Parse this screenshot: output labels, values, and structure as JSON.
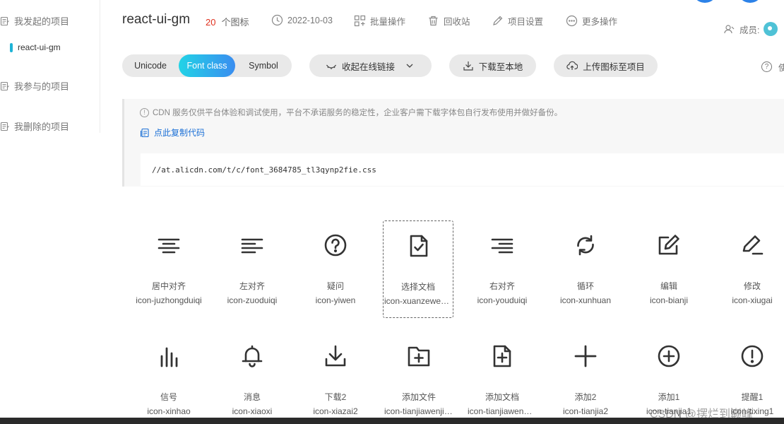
{
  "sidebar": {
    "groups": [
      {
        "label": "我发起的项目",
        "icon": "project-icon"
      },
      {
        "label": "我参与的项目",
        "icon": "project-icon"
      },
      {
        "label": "我删除的项目",
        "icon": "project-icon"
      }
    ],
    "active_project": "react-ui-gm"
  },
  "header": {
    "title": "react-ui-gm",
    "icon_count": "20",
    "icon_count_unit": "个图标",
    "date": "2022-10-03",
    "batch": "批量操作",
    "recycle": "回收站",
    "settings": "项目设置",
    "more": "更多操作",
    "members_label": "成员:"
  },
  "toolbar": {
    "tabs": [
      "Unicode",
      "Font class",
      "Symbol"
    ],
    "active_tab": "Font class",
    "collapse_link": "收起在线链接",
    "download": "下载至本地",
    "upload": "上传图标至项目",
    "help": "?",
    "help_more": "使"
  },
  "notice": {
    "text": "CDN 服务仅供平台体验和调试使用，平台不承诺服务的稳定性，企业客户需下载字体包自行发布使用并做好备份。",
    "copy_label": "点此复制代码",
    "code": "//at.alicdn.com/t/c/font_3684785_tl3qynp2fie.css"
  },
  "icons": [
    {
      "name": "居中对齐",
      "code": "icon-juzhongduiqi",
      "glyph": "align-center-icon"
    },
    {
      "name": "左对齐",
      "code": "icon-zuoduiqi",
      "glyph": "align-left-icon"
    },
    {
      "name": "疑问",
      "code": "icon-yiwen",
      "glyph": "question-icon"
    },
    {
      "name": "选择文档",
      "code": "icon-xuanzewendang",
      "glyph": "document-check-icon",
      "selected": true
    },
    {
      "name": "右对齐",
      "code": "icon-youduiqi",
      "glyph": "align-right-icon"
    },
    {
      "name": "循环",
      "code": "icon-xunhuan",
      "glyph": "loop-icon"
    },
    {
      "name": "编辑",
      "code": "icon-bianji",
      "glyph": "edit-icon"
    },
    {
      "name": "修改",
      "code": "icon-xiugai",
      "glyph": "pen-icon"
    },
    {
      "name": "信号",
      "code": "icon-xinhao",
      "glyph": "signal-icon"
    },
    {
      "name": "消息",
      "code": "icon-xiaoxi",
      "glyph": "bell-icon"
    },
    {
      "name": "下载2",
      "code": "icon-xiazai2",
      "glyph": "download-icon"
    },
    {
      "name": "添加文件",
      "code": "icon-tianjiawenjian",
      "glyph": "folder-add-icon"
    },
    {
      "name": "添加文档",
      "code": "icon-tianjiawendang",
      "glyph": "document-add-icon"
    },
    {
      "name": "添加2",
      "code": "icon-tianjia2",
      "glyph": "plus-icon"
    },
    {
      "name": "添加1",
      "code": "icon-tianjia1",
      "glyph": "plus-circle-icon"
    },
    {
      "name": "提醒1",
      "code": "icon-tixing1",
      "glyph": "alert-circle-icon"
    }
  ],
  "watermark": "CSDN @摆烂到巅峰",
  "colors": {
    "accent": "#22d3e6",
    "link": "#1a6fd6",
    "count": "#e0301e"
  }
}
